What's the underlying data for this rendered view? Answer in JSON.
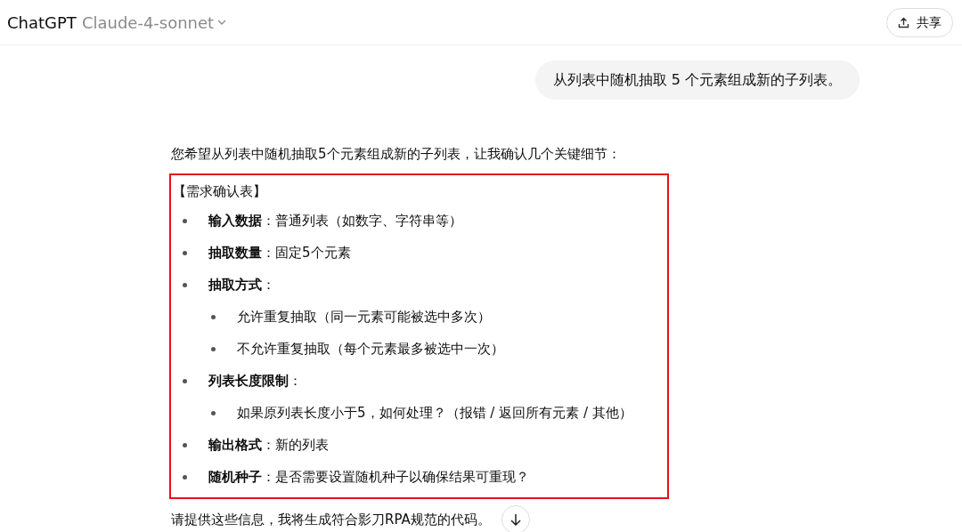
{
  "header": {
    "app_title": "ChatGPT",
    "model": "Claude-4-sonnet",
    "share_button": "共享"
  },
  "user_message": "从列表中随机抽取 5 个元素组成新的子列表。",
  "assistant": {
    "intro": "您希望从列表中随机抽取5个元素组成新的子列表，让我确认几个关键细节：",
    "highlighted": true,
    "block_title": "【需求确认表】",
    "items": [
      {
        "text": "**输入数据**：普通列表（如数字、字符串等）"
      },
      {
        "text": "**抽取数量**：固定5个元素"
      },
      {
        "text": "**抽取方式**：",
        "children": [
          {
            "text": "允许重复抽取（同一元素可能被选中多次）"
          },
          {
            "text": "不允许重复抽取（每个元素最多被选中一次）"
          }
        ]
      },
      {
        "text": "**列表长度限制**：",
        "children": [
          {
            "text": "如果原列表长度小于5，如何处理？（报错 / 返回所有元素 / 其他）"
          }
        ]
      },
      {
        "text": "**输出格式**：新的列表"
      },
      {
        "text": "**随机种子**：是否需要设置随机种子以确保结果可重现？"
      }
    ],
    "closing": "请提供这些信息，我将生成符合影刀RPA规范的代码。"
  }
}
